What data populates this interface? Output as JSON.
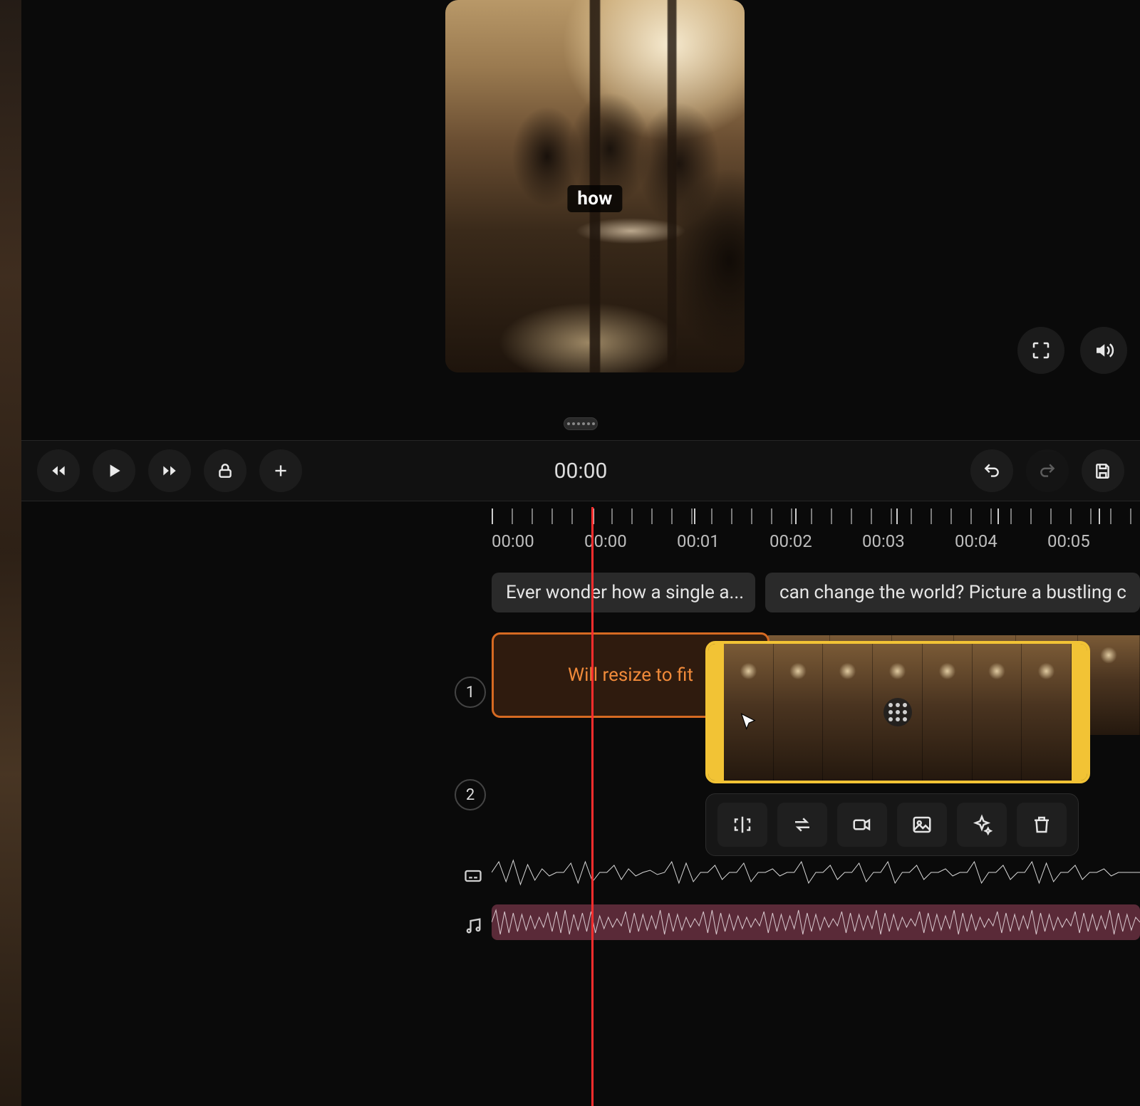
{
  "preview": {
    "caption_word": "how"
  },
  "toolbar": {
    "time": "00:00"
  },
  "ruler": {
    "labels": [
      "00:00",
      "00:00",
      "00:01",
      "00:02",
      "00:03",
      "00:04",
      "00:05"
    ]
  },
  "captions": {
    "chip1": "Ever wonder how a single a...",
    "chip2": "can change the world? Picture a bustling c"
  },
  "tracks": {
    "t1_number": "1",
    "t2_number": "2",
    "resize_label": "Will resize to fit"
  },
  "colors": {
    "playhead": "#ff2d2d",
    "selection_border": "#f2c335",
    "resize_border": "#d66a22",
    "resize_text": "#f08a3a",
    "music_bg": "#5a2a38"
  }
}
